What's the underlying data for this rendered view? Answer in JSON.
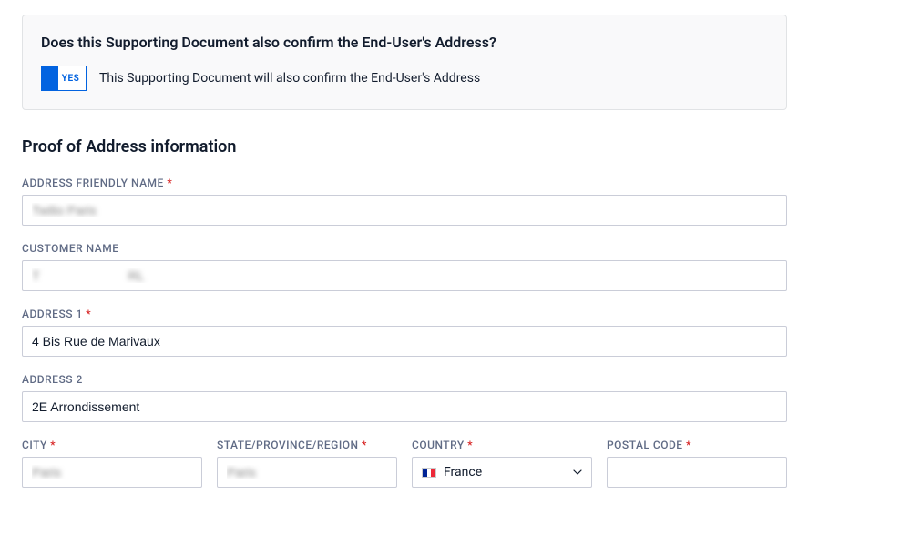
{
  "confirm": {
    "title": "Does this Supporting Document also confirm the End-User's Address?",
    "toggle_label": "YES",
    "description": "This Supporting Document will also confirm the End-User's Address"
  },
  "section": {
    "heading": "Proof of Address information"
  },
  "fields": {
    "friendly_name": {
      "label": "ADDRESS FRIENDLY NAME",
      "required": "*",
      "value": "Twilio Paris"
    },
    "customer_name": {
      "label": "CUSTOMER NAME",
      "value": "T                         RL"
    },
    "address1": {
      "label": "ADDRESS 1",
      "required": "*",
      "value": "4 Bis Rue de Marivaux"
    },
    "address2": {
      "label": "ADDRESS 2",
      "value": "2E Arrondissement"
    },
    "city": {
      "label": "CITY",
      "required": "*",
      "value": "Paris"
    },
    "state": {
      "label": "STATE/PROVINCE/REGION",
      "required": "*",
      "value": "Paris"
    },
    "country": {
      "label": "COUNTRY",
      "required": "*",
      "value": "France"
    },
    "postal": {
      "label": "POSTAL CODE",
      "required": "*",
      "value": ""
    }
  }
}
